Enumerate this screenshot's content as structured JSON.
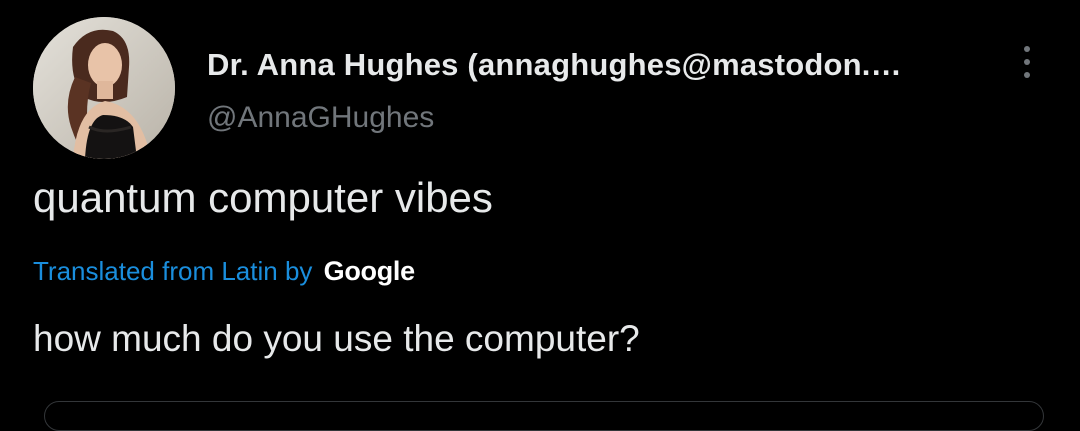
{
  "author": {
    "display_name": "Dr. Anna Hughes (annaghughes@mastodon.…",
    "handle": "@AnnaGHughes",
    "avatar_icon": "profile-photo"
  },
  "more_icon": "more-vertical-icon",
  "tweet": {
    "text": "quantum computer vibes",
    "translation_link": "Translated from Latin",
    "translation_by": "by",
    "translation_service": "Google",
    "translated_text": "how much do you use the computer?"
  },
  "colors": {
    "background": "#000000",
    "primary_text": "#e7e9ea",
    "secondary_text": "#71767b",
    "link": "#1d9bf0"
  }
}
